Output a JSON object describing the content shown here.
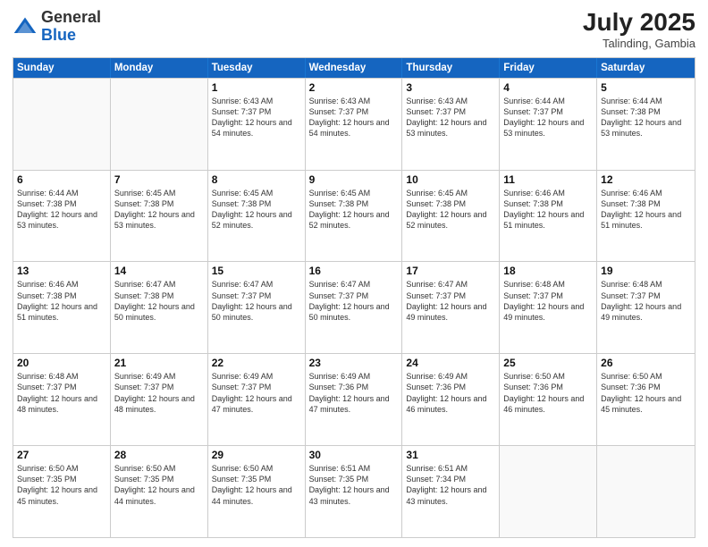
{
  "logo": {
    "general": "General",
    "blue": "Blue"
  },
  "header": {
    "month_year": "July 2025",
    "location": "Talinding, Gambia"
  },
  "days_of_week": [
    "Sunday",
    "Monday",
    "Tuesday",
    "Wednesday",
    "Thursday",
    "Friday",
    "Saturday"
  ],
  "weeks": [
    [
      {
        "day": "",
        "info": ""
      },
      {
        "day": "",
        "info": ""
      },
      {
        "day": "1",
        "info": "Sunrise: 6:43 AM\nSunset: 7:37 PM\nDaylight: 12 hours and 54 minutes."
      },
      {
        "day": "2",
        "info": "Sunrise: 6:43 AM\nSunset: 7:37 PM\nDaylight: 12 hours and 54 minutes."
      },
      {
        "day": "3",
        "info": "Sunrise: 6:43 AM\nSunset: 7:37 PM\nDaylight: 12 hours and 53 minutes."
      },
      {
        "day": "4",
        "info": "Sunrise: 6:44 AM\nSunset: 7:37 PM\nDaylight: 12 hours and 53 minutes."
      },
      {
        "day": "5",
        "info": "Sunrise: 6:44 AM\nSunset: 7:38 PM\nDaylight: 12 hours and 53 minutes."
      }
    ],
    [
      {
        "day": "6",
        "info": "Sunrise: 6:44 AM\nSunset: 7:38 PM\nDaylight: 12 hours and 53 minutes."
      },
      {
        "day": "7",
        "info": "Sunrise: 6:45 AM\nSunset: 7:38 PM\nDaylight: 12 hours and 53 minutes."
      },
      {
        "day": "8",
        "info": "Sunrise: 6:45 AM\nSunset: 7:38 PM\nDaylight: 12 hours and 52 minutes."
      },
      {
        "day": "9",
        "info": "Sunrise: 6:45 AM\nSunset: 7:38 PM\nDaylight: 12 hours and 52 minutes."
      },
      {
        "day": "10",
        "info": "Sunrise: 6:45 AM\nSunset: 7:38 PM\nDaylight: 12 hours and 52 minutes."
      },
      {
        "day": "11",
        "info": "Sunrise: 6:46 AM\nSunset: 7:38 PM\nDaylight: 12 hours and 51 minutes."
      },
      {
        "day": "12",
        "info": "Sunrise: 6:46 AM\nSunset: 7:38 PM\nDaylight: 12 hours and 51 minutes."
      }
    ],
    [
      {
        "day": "13",
        "info": "Sunrise: 6:46 AM\nSunset: 7:38 PM\nDaylight: 12 hours and 51 minutes."
      },
      {
        "day": "14",
        "info": "Sunrise: 6:47 AM\nSunset: 7:38 PM\nDaylight: 12 hours and 50 minutes."
      },
      {
        "day": "15",
        "info": "Sunrise: 6:47 AM\nSunset: 7:37 PM\nDaylight: 12 hours and 50 minutes."
      },
      {
        "day": "16",
        "info": "Sunrise: 6:47 AM\nSunset: 7:37 PM\nDaylight: 12 hours and 50 minutes."
      },
      {
        "day": "17",
        "info": "Sunrise: 6:47 AM\nSunset: 7:37 PM\nDaylight: 12 hours and 49 minutes."
      },
      {
        "day": "18",
        "info": "Sunrise: 6:48 AM\nSunset: 7:37 PM\nDaylight: 12 hours and 49 minutes."
      },
      {
        "day": "19",
        "info": "Sunrise: 6:48 AM\nSunset: 7:37 PM\nDaylight: 12 hours and 49 minutes."
      }
    ],
    [
      {
        "day": "20",
        "info": "Sunrise: 6:48 AM\nSunset: 7:37 PM\nDaylight: 12 hours and 48 minutes."
      },
      {
        "day": "21",
        "info": "Sunrise: 6:49 AM\nSunset: 7:37 PM\nDaylight: 12 hours and 48 minutes."
      },
      {
        "day": "22",
        "info": "Sunrise: 6:49 AM\nSunset: 7:37 PM\nDaylight: 12 hours and 47 minutes."
      },
      {
        "day": "23",
        "info": "Sunrise: 6:49 AM\nSunset: 7:36 PM\nDaylight: 12 hours and 47 minutes."
      },
      {
        "day": "24",
        "info": "Sunrise: 6:49 AM\nSunset: 7:36 PM\nDaylight: 12 hours and 46 minutes."
      },
      {
        "day": "25",
        "info": "Sunrise: 6:50 AM\nSunset: 7:36 PM\nDaylight: 12 hours and 46 minutes."
      },
      {
        "day": "26",
        "info": "Sunrise: 6:50 AM\nSunset: 7:36 PM\nDaylight: 12 hours and 45 minutes."
      }
    ],
    [
      {
        "day": "27",
        "info": "Sunrise: 6:50 AM\nSunset: 7:35 PM\nDaylight: 12 hours and 45 minutes."
      },
      {
        "day": "28",
        "info": "Sunrise: 6:50 AM\nSunset: 7:35 PM\nDaylight: 12 hours and 44 minutes."
      },
      {
        "day": "29",
        "info": "Sunrise: 6:50 AM\nSunset: 7:35 PM\nDaylight: 12 hours and 44 minutes."
      },
      {
        "day": "30",
        "info": "Sunrise: 6:51 AM\nSunset: 7:35 PM\nDaylight: 12 hours and 43 minutes."
      },
      {
        "day": "31",
        "info": "Sunrise: 6:51 AM\nSunset: 7:34 PM\nDaylight: 12 hours and 43 minutes."
      },
      {
        "day": "",
        "info": ""
      },
      {
        "day": "",
        "info": ""
      }
    ]
  ]
}
